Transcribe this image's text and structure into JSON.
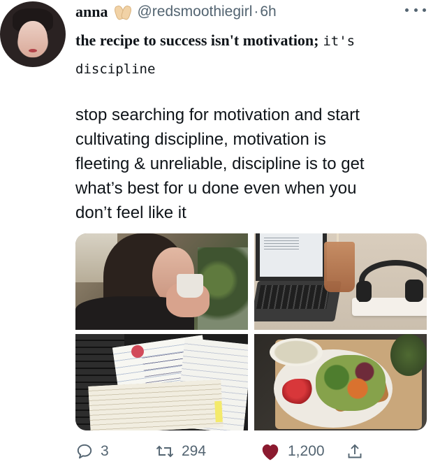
{
  "author": {
    "name": "anna",
    "handle": "@redsmoothiegirl",
    "separator": "·",
    "time": "6h",
    "emoji_icon": "palms-together-icon"
  },
  "tweet": {
    "headline_bold": "the recipe to success isn't motivation;",
    "headline_mono": "it's discipline",
    "body_lines": [
      "stop searching for motivation and start",
      "cultivating discipline, motivation is",
      "fleeting & unreliable, discipline is to get",
      "what’s best for u done even when you",
      "don’t feel like it"
    ]
  },
  "media": [
    {
      "name": "photo-woman-drinking-coffee"
    },
    {
      "name": "photo-laptop-iced-coffee-headphones"
    },
    {
      "name": "photo-notebooks-studying"
    },
    {
      "name": "photo-salad-and-toast-tray"
    }
  ],
  "actions": {
    "reply_count": "3",
    "retweet_count": "294",
    "like_count": "1,200",
    "like_color": "#8b1a2f",
    "icon_color": "#536471"
  }
}
